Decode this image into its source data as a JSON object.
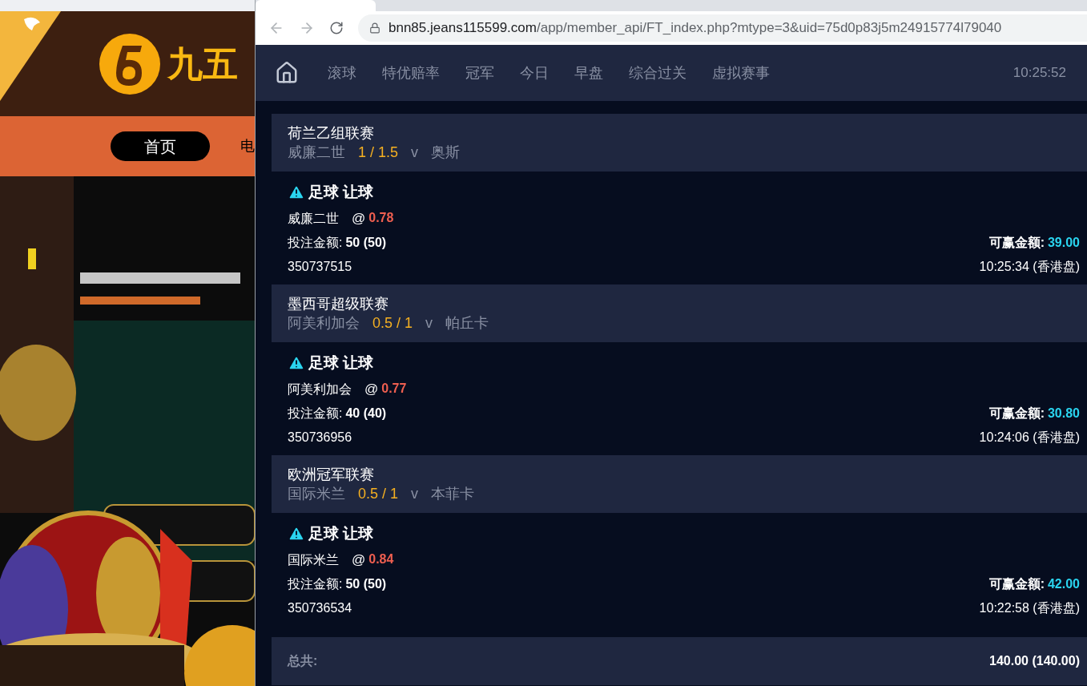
{
  "background_site": {
    "logo_text": "九五",
    "nav": [
      {
        "label": "首页",
        "selected": true
      },
      {
        "label": "电",
        "selected": false
      }
    ]
  },
  "browser": {
    "host": "bnn85.jeans115599.com",
    "path": "/app/member_api/FT_index.php?mtype=3&uid=75d0p83j5m24915774l79040"
  },
  "nav": {
    "items": [
      {
        "label": "滚球",
        "selected": false
      },
      {
        "label": "特优赔率",
        "selected": false
      },
      {
        "label": "冠军",
        "selected": false
      },
      {
        "label": "今日",
        "selected": false
      },
      {
        "label": "早盘",
        "selected": false
      },
      {
        "label": "综合过关",
        "selected": false
      },
      {
        "label": "虚拟赛事",
        "selected": false
      }
    ],
    "time": "10:25:52"
  },
  "bets": [
    {
      "league": "荷兰乙组联赛",
      "home": "威廉二世",
      "handicap": "1 / 1.5",
      "vs": "v",
      "away": "奥斯",
      "sport": "足球 让球",
      "pick": "威廉二世",
      "at": "@",
      "odds": "0.78",
      "stake_label": "投注金额:",
      "stake": "50 (50)",
      "win_label": "可赢金额:",
      "win": "39.00",
      "ticket": "350737515",
      "time": "10:25:34 (香港盘)"
    },
    {
      "league": "墨西哥超级联赛",
      "home": "阿美利加会",
      "handicap": "0.5 / 1",
      "vs": "v",
      "away": "帕丘卡",
      "sport": "足球 让球",
      "pick": "阿美利加会",
      "at": "@",
      "odds": "0.77",
      "stake_label": "投注金额:",
      "stake": "40 (40)",
      "win_label": "可赢金额:",
      "win": "30.80",
      "ticket": "350736956",
      "time": "10:24:06 (香港盘)"
    },
    {
      "league": "欧洲冠军联赛",
      "home": "国际米兰",
      "handicap": "0.5 / 1",
      "vs": "v",
      "away": "本菲卡",
      "sport": "足球 让球",
      "pick": "国际米兰",
      "at": "@",
      "odds": "0.84",
      "stake_label": "投注金额:",
      "stake": "50 (50)",
      "win_label": "可赢金额:",
      "win": "42.00",
      "ticket": "350736534",
      "time": "10:22:58 (香港盘)"
    }
  ],
  "total": {
    "label": "总共:",
    "value": "140.00 (140.00)"
  }
}
